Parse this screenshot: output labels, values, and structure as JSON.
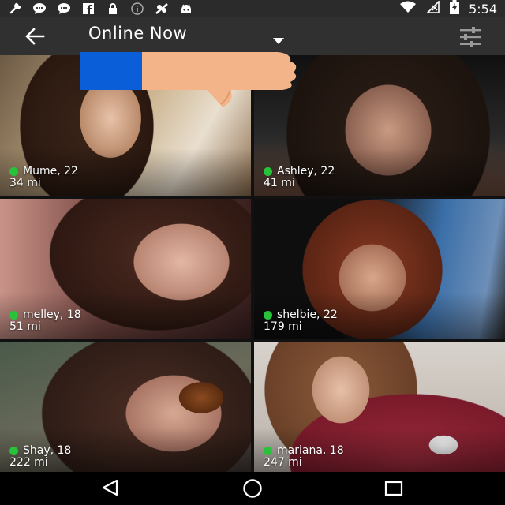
{
  "status_bar": {
    "icons": [
      "wrench-icon",
      "chat-bubble-icon",
      "chat-bubble-icon",
      "facebook-icon",
      "lock-icon",
      "info-icon",
      "vpn-icon",
      "android-icon"
    ],
    "wifi": "wifi-icon",
    "signal": "no-signal-icon",
    "battery": "battery-charging-icon",
    "time": "5:54"
  },
  "app_bar": {
    "title": "Online Now",
    "back": "arrow-left-icon",
    "dropdown": "caret-down-icon",
    "filter": "sliders-icon"
  },
  "profiles": [
    {
      "name_age": "Mume, 22",
      "distance": "34 mi",
      "online": true
    },
    {
      "name_age": "Ashley, 22",
      "distance": "41 mi",
      "online": true
    },
    {
      "name_age": "melley, 18",
      "distance": "51 mi",
      "online": true
    },
    {
      "name_age": "shelbie, 22",
      "distance": "179 mi",
      "online": true
    },
    {
      "name_age": "Shay, 18",
      "distance": "222 mi",
      "online": true
    },
    {
      "name_age": "mariana, 18",
      "distance": "247 mi",
      "online": true
    }
  ],
  "overlay": {
    "icon": "thumbs-down-icon",
    "accent": "#0a5fd8",
    "skin": "#f4b48a"
  },
  "nav_bar": {
    "back": "nav-back-icon",
    "home": "nav-home-icon",
    "recents": "nav-recents-icon"
  },
  "colors": {
    "online_dot": "#27c23a",
    "app_bar": "#303030",
    "status_bar": "#2b2b2b"
  }
}
